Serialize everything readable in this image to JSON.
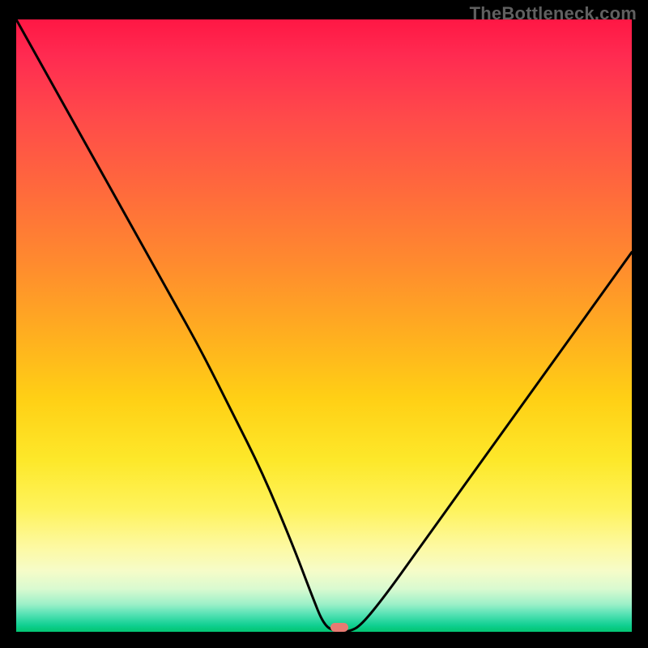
{
  "watermark": "TheBottleneck.com",
  "colors": {
    "background": "#000000",
    "watermark": "#606060",
    "curve": "#000000",
    "marker": "#e77a72",
    "gradient_top": "#ff1744",
    "gradient_bottom": "#04c673"
  },
  "chart_data": {
    "type": "line",
    "title": "",
    "xlabel": "",
    "ylabel": "",
    "xlim": [
      0,
      100
    ],
    "ylim": [
      0,
      100
    ],
    "grid": false,
    "legend": false,
    "series": [
      {
        "name": "bottleneck-curve",
        "x": [
          0,
          5,
          10,
          15,
          20,
          25,
          30,
          35,
          40,
          45,
          48,
          50,
          52,
          54,
          56,
          60,
          65,
          70,
          75,
          80,
          85,
          90,
          95,
          100
        ],
        "y": [
          100,
          91,
          82,
          73,
          64,
          55,
          46,
          36,
          26,
          14,
          6,
          1,
          0,
          0,
          1,
          6,
          13,
          20,
          27,
          34,
          41,
          48,
          55,
          62
        ]
      }
    ],
    "annotations": [
      {
        "name": "optimal-marker",
        "x": 52.5,
        "y": 0.7,
        "width_pct": 2.8,
        "height_pct": 1.4
      }
    ],
    "notes": "x and y are in percent of the plot area (0-100). Values were estimated visually; no axis ticks or labels are present in the image. The curve depicts a bottleneck metric that drops to ~0 near x≈52 and rises on both sides. Background is a vertical red→yellow→green gradient with a thin green band at the bottom edge."
  }
}
